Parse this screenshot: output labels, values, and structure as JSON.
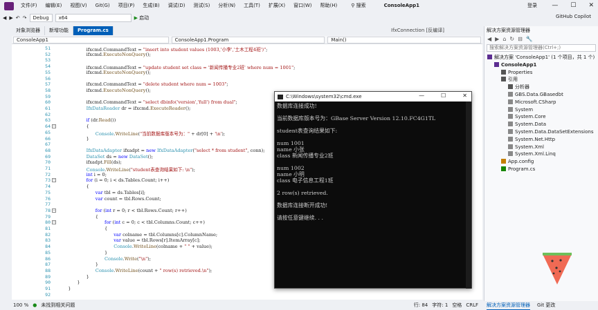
{
  "menu": [
    "文件(F)",
    "编辑(E)",
    "视图(V)",
    "Git(G)",
    "项目(P)",
    "生成(B)",
    "调试(D)",
    "测试(S)",
    "分析(N)",
    "工具(T)",
    "扩展(X)",
    "窗口(W)",
    "帮助(H)"
  ],
  "search_label": "搜索",
  "app_name": "ConsoleApp1",
  "login": "登录",
  "copilot": "GitHub Copilot",
  "toolbar": {
    "config": "Debug",
    "platform": "x64",
    "start": "启动"
  },
  "tabs": [
    "对象浏览器",
    "新增功能",
    "Program.cs"
  ],
  "tab_ifx": "IfxConnection [反编译]",
  "nav": {
    "project": "ConsoleApp1",
    "class": "ConsoleApp1.Program",
    "member": "Main()"
  },
  "line_numbers": [
    "51",
    "52",
    "53",
    "54",
    "55",
    "56",
    "57",
    "58",
    "59",
    "60",
    "61",
    "62",
    "63",
    "64",
    "65",
    "66",
    "67",
    "68",
    "69",
    "70",
    "71",
    "72",
    "73",
    "74",
    "75",
    "76",
    "77",
    "78",
    "79",
    "80",
    "81",
    "82",
    "83",
    "84",
    "85",
    "86",
    "87",
    "88",
    "89",
    "90",
    "91",
    "92"
  ],
  "code": [
    {
      "ind": 6,
      "parts": [
        [
          "",
          "ifxcmd.CommandText = "
        ],
        [
          "st",
          "\"insert into student values (1003,'小李','土木工程4班')\""
        ],
        [
          "",
          ";"
        ]
      ]
    },
    {
      "ind": 6,
      "parts": [
        [
          "",
          "ifxcmd."
        ],
        [
          "me",
          "ExecuteNonQuery"
        ],
        [
          "",
          "();"
        ]
      ]
    },
    {
      "ind": 0,
      "parts": []
    },
    {
      "ind": 6,
      "parts": [
        [
          "",
          "ifxcmd.CommandText = "
        ],
        [
          "st",
          "\"update student set class = '新闻传播专业2班' where num = 1001\""
        ],
        [
          "",
          ";"
        ]
      ]
    },
    {
      "ind": 6,
      "parts": [
        [
          "",
          "ifxcmd."
        ],
        [
          "me",
          "ExecuteNonQuery"
        ],
        [
          "",
          "();"
        ]
      ]
    },
    {
      "ind": 0,
      "parts": []
    },
    {
      "ind": 6,
      "parts": [
        [
          "",
          "ifxcmd.CommandText = "
        ],
        [
          "st",
          "\"delete student where num = 1003\""
        ],
        [
          "",
          ";"
        ]
      ]
    },
    {
      "ind": 6,
      "parts": [
        [
          "",
          "ifxcmd."
        ],
        [
          "me",
          "ExecuteNonQuery"
        ],
        [
          "",
          "();"
        ]
      ]
    },
    {
      "ind": 0,
      "parts": []
    },
    {
      "ind": 6,
      "parts": [
        [
          "",
          "ifxcmd.CommandText = "
        ],
        [
          "st",
          "\"select dbinfo('version','full') from dual\""
        ],
        [
          "",
          ";"
        ]
      ]
    },
    {
      "ind": 6,
      "parts": [
        [
          "ty",
          "IfxDataReader"
        ],
        [
          "",
          " dr = ifxcmd."
        ],
        [
          "me",
          "ExecuteReader"
        ],
        [
          "",
          "();"
        ]
      ]
    },
    {
      "ind": 0,
      "parts": []
    },
    {
      "ind": 6,
      "parts": [
        [
          "kw",
          "if"
        ],
        [
          "",
          " (dr."
        ],
        [
          "me",
          "Read"
        ],
        [
          "",
          "())"
        ]
      ]
    },
    {
      "ind": 6,
      "parts": [
        [
          "",
          "{"
        ]
      ]
    },
    {
      "ind": 8,
      "parts": [
        [
          "ty",
          "Console"
        ],
        [
          "",
          "."
        ],
        [
          "me",
          "WriteLine"
        ],
        [
          "",
          "("
        ],
        [
          "st",
          "\"当前数据库版本号为：\""
        ],
        [
          "",
          " + dr[0] + "
        ],
        [
          "st",
          "'\\n'"
        ],
        [
          "",
          ");"
        ]
      ]
    },
    {
      "ind": 6,
      "parts": [
        [
          "",
          "}"
        ]
      ]
    },
    {
      "ind": 0,
      "parts": []
    },
    {
      "ind": 6,
      "parts": [
        [
          "ty",
          "IfxDataAdapter"
        ],
        [
          "",
          " ifxadpt = "
        ],
        [
          "kw",
          "new"
        ],
        [
          "",
          " "
        ],
        [
          "ty",
          "IfxDataAdapter"
        ],
        [
          "",
          "("
        ],
        [
          "st",
          "\"select * from student\""
        ],
        [
          "",
          ", conn);"
        ]
      ]
    },
    {
      "ind": 6,
      "parts": [
        [
          "ty",
          "DataSet"
        ],
        [
          "",
          " ds = "
        ],
        [
          "kw",
          "new"
        ],
        [
          "",
          " "
        ],
        [
          "ty",
          "DataSet"
        ],
        [
          "",
          "();"
        ]
      ]
    },
    {
      "ind": 6,
      "parts": [
        [
          "",
          "ifxadpt."
        ],
        [
          "me",
          "Fill"
        ],
        [
          "",
          "(ds);"
        ]
      ]
    },
    {
      "ind": 6,
      "parts": [
        [
          "ty",
          "Console"
        ],
        [
          "",
          "."
        ],
        [
          "me",
          "WriteLine"
        ],
        [
          "",
          "("
        ],
        [
          "st",
          "\"student表查询结果如下: \\n\""
        ],
        [
          "",
          ");"
        ]
      ]
    },
    {
      "ind": 6,
      "parts": [
        [
          "kw",
          "int"
        ],
        [
          "",
          " i = 0;"
        ]
      ]
    },
    {
      "ind": 6,
      "parts": [
        [
          "kw",
          "for"
        ],
        [
          "",
          " (i = 0; i < ds.Tables.Count; i++)"
        ]
      ]
    },
    {
      "ind": 6,
      "parts": [
        [
          "",
          "{"
        ]
      ]
    },
    {
      "ind": 8,
      "parts": [
        [
          "kw",
          "var"
        ],
        [
          "",
          " tbl = ds.Tables[i];"
        ]
      ]
    },
    {
      "ind": 8,
      "parts": [
        [
          "kw",
          "var"
        ],
        [
          "",
          " count = tbl.Rows.Count;"
        ]
      ]
    },
    {
      "ind": 0,
      "parts": []
    },
    {
      "ind": 8,
      "parts": [
        [
          "kw",
          "for"
        ],
        [
          "",
          " ("
        ],
        [
          "kw",
          "int"
        ],
        [
          "",
          " r = 0; r < tbl.Rows.Count; r++)"
        ]
      ]
    },
    {
      "ind": 8,
      "parts": [
        [
          "",
          "{"
        ]
      ]
    },
    {
      "ind": 10,
      "parts": [
        [
          "kw",
          "for"
        ],
        [
          "",
          " ("
        ],
        [
          "kw",
          "int"
        ],
        [
          "",
          " c = 0; c < tbl.Columns.Count; c++)"
        ]
      ]
    },
    {
      "ind": 10,
      "parts": [
        [
          "",
          "{"
        ]
      ]
    },
    {
      "ind": 12,
      "parts": [
        [
          "kw",
          "var"
        ],
        [
          "",
          " colname = tbl.Columns[c].ColumnName;"
        ]
      ]
    },
    {
      "ind": 12,
      "parts": [
        [
          "kw",
          "var"
        ],
        [
          "",
          " value = tbl.Rows[r].ItemArray[c];"
        ]
      ]
    },
    {
      "ind": 12,
      "parts": [
        [
          "ty",
          "Console"
        ],
        [
          "",
          "."
        ],
        [
          "me",
          "WriteLine"
        ],
        [
          "",
          "(colname + "
        ],
        [
          "st",
          "\" \""
        ],
        [
          "",
          " + value);"
        ]
      ]
    },
    {
      "ind": 10,
      "parts": [
        [
          "",
          "}"
        ]
      ]
    },
    {
      "ind": 10,
      "parts": [
        [
          "ty",
          "Console"
        ],
        [
          "",
          "."
        ],
        [
          "me",
          "Write"
        ],
        [
          "",
          "("
        ],
        [
          "st",
          "\"\\n\""
        ],
        [
          "",
          ");"
        ]
      ]
    },
    {
      "ind": 8,
      "parts": [
        [
          "",
          "}"
        ]
      ]
    },
    {
      "ind": 8,
      "parts": [
        [
          "ty",
          "Console"
        ],
        [
          "",
          "."
        ],
        [
          "me",
          "WriteLine"
        ],
        [
          "",
          "(count + "
        ],
        [
          "st",
          "\" row(s) retrieved.\\n\""
        ],
        [
          "",
          ");"
        ]
      ]
    },
    {
      "ind": 6,
      "parts": [
        [
          "",
          "}"
        ]
      ]
    },
    {
      "ind": 4,
      "parts": [
        [
          "",
          "}"
        ]
      ]
    },
    {
      "ind": 2,
      "parts": [
        [
          "",
          "}"
        ]
      ]
    },
    {
      "ind": 0,
      "parts": []
    }
  ],
  "status": {
    "zoom": "100 %",
    "issues": "未找到相关问题",
    "line": "行: 84",
    "char": "字符: 1",
    "spaces": "空格",
    "eol": "CRLF"
  },
  "cmd": {
    "title": "C:\\Windows\\system32\\cmd.exe",
    "lines": [
      "数据库连接成功!",
      "",
      "当前数据库版本号为：GBase Server Version 12.10.FC4G1TL",
      "",
      "student表查询结果如下:",
      "",
      "num 1001",
      "name 小张",
      "class 新闻传播专业2班",
      "",
      "num 1002",
      "name 小明",
      "class 电子信息工程1班",
      "",
      "2 row(s) retrieved.",
      "",
      "数据库连接断开成功!",
      "",
      "请按任意键继续. . ."
    ]
  },
  "solution": {
    "title": "解决方案资源管理器",
    "search_placeholder": "搜索解决方案资源管理器(Ctrl+;)",
    "items": [
      {
        "label": "解决方案 'ConsoleApp1' (1 个项目，共 1 个)",
        "depth": 0
      },
      {
        "label": "ConsoleApp1",
        "depth": 1
      },
      {
        "label": "Properties",
        "depth": 2
      },
      {
        "label": "引用",
        "depth": 2
      },
      {
        "label": "分析器",
        "depth": 3
      },
      {
        "label": "GBS.Data.GBasedbt",
        "depth": 3
      },
      {
        "label": "Microsoft.CSharp",
        "depth": 3
      },
      {
        "label": "System",
        "depth": 3
      },
      {
        "label": "System.Core",
        "depth": 3
      },
      {
        "label": "System.Data",
        "depth": 3
      },
      {
        "label": "System.Data.DataSetExtensions",
        "depth": 3
      },
      {
        "label": "System.Net.Http",
        "depth": 3
      },
      {
        "label": "System.Xml",
        "depth": 3
      },
      {
        "label": "System.Xml.Linq",
        "depth": 3
      },
      {
        "label": "App.config",
        "depth": 2
      },
      {
        "label": "Program.cs",
        "depth": 2
      }
    ],
    "bottom_tabs": [
      "解决方案资源管理器",
      "Git 更改"
    ]
  },
  "colors": {
    "accent": "#005fb8",
    "keyword": "#0000ff",
    "type": "#2b91af",
    "string": "#a31515"
  }
}
